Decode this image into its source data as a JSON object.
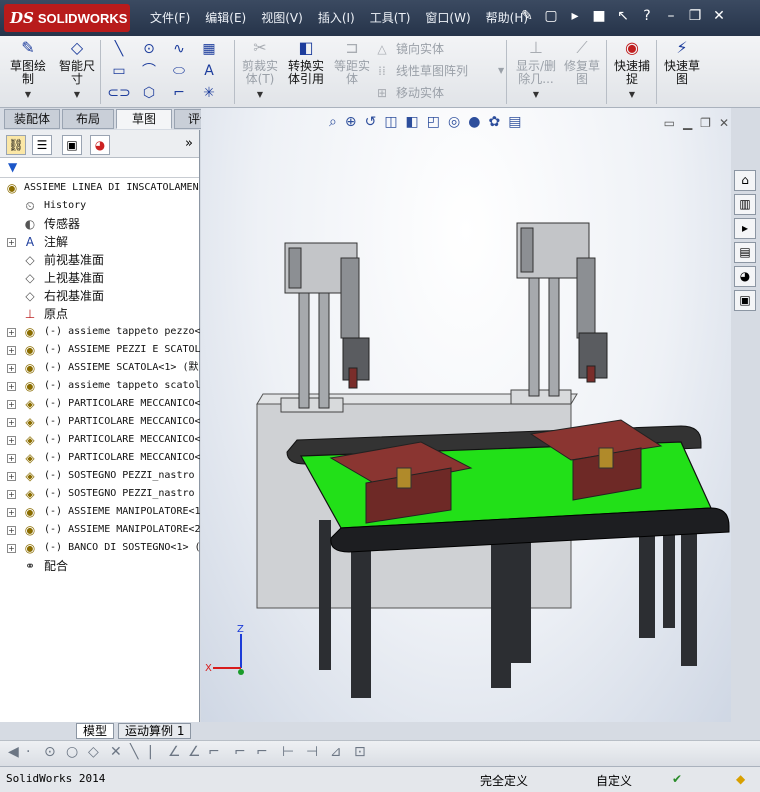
{
  "app": {
    "logo_prefix": "DS",
    "logo_name": "SOLIDWORKS"
  },
  "menu": [
    "文件(F)",
    "编辑(E)",
    "视图(V)",
    "插入(I)",
    "工具(T)",
    "窗口(W)",
    "帮助(H)"
  ],
  "ribbon": {
    "sketch": "草图绘\n制",
    "smart_dim": "智能尺\n寸",
    "trim": "剪裁实\n体(T)",
    "convert": "转换实\n体引用",
    "offset": "等距实\n体",
    "mirror": "镜向实体",
    "linear_pattern": "线性草图阵列",
    "move": "移动实体",
    "show_delete": "显示/删\n除几...",
    "repair": "修复草\n图",
    "quick_snap": "快速捕\n捉",
    "rapid_sketch": "快速草\n图"
  },
  "tabs": [
    "装配体",
    "布局",
    "草图",
    "评估"
  ],
  "active_tab": "草图",
  "tree": {
    "root": "ASSIEME LINEA DI INSCATOLAMEN",
    "items": [
      {
        "type": "history",
        "label": "History"
      },
      {
        "type": "sensor",
        "label": "传感器"
      },
      {
        "type": "annotation",
        "label": "注解",
        "expand": true
      },
      {
        "type": "plane",
        "label": "前视基准面"
      },
      {
        "type": "plane",
        "label": "上视基准面"
      },
      {
        "type": "plane",
        "label": "右视基准面"
      },
      {
        "type": "origin",
        "label": "原点"
      },
      {
        "type": "asm",
        "label": "(-) assieme tappeto pezzo<"
      },
      {
        "type": "asm",
        "label": "(-) ASSIEME PEZZI E SCATOL"
      },
      {
        "type": "asm",
        "label": "(-) ASSIEME SCATOLA<1> (默"
      },
      {
        "type": "asm",
        "label": "(-) assieme tappeto scatol"
      },
      {
        "type": "part",
        "label": "(-) PARTICOLARE MECCANICO<"
      },
      {
        "type": "part",
        "label": "(-) PARTICOLARE MECCANICO<"
      },
      {
        "type": "part",
        "label": "(-) PARTICOLARE MECCANICO<"
      },
      {
        "type": "part",
        "label": "(-) PARTICOLARE MECCANICO<"
      },
      {
        "type": "part",
        "label": "(-) SOSTEGNO PEZZI_nastro"
      },
      {
        "type": "part",
        "label": "(-) SOSTEGNO PEZZI_nastro"
      },
      {
        "type": "asm",
        "label": "(-) ASSIEME MANIPOLATORE<1"
      },
      {
        "type": "asm",
        "label": "(-) ASSIEME MANIPOLATORE<2"
      },
      {
        "type": "asm",
        "label": "(-) BANCO DI SOSTEGNO<1> ("
      },
      {
        "type": "mates",
        "label": "配合"
      }
    ]
  },
  "bottom_tabs": [
    "模型",
    "运动算例 1"
  ],
  "status": {
    "version": "SolidWorks 2014",
    "defined": "完全定义",
    "custom": "自定义"
  },
  "colors": {
    "conveyor_belt": "#22e018",
    "box": "#7a2d2a",
    "frame": "#8a8d92",
    "leg": "#2c2e32",
    "base": "#cfd1d4",
    "title_bar": "#2e3c52",
    "logo": "#b81b1b"
  }
}
